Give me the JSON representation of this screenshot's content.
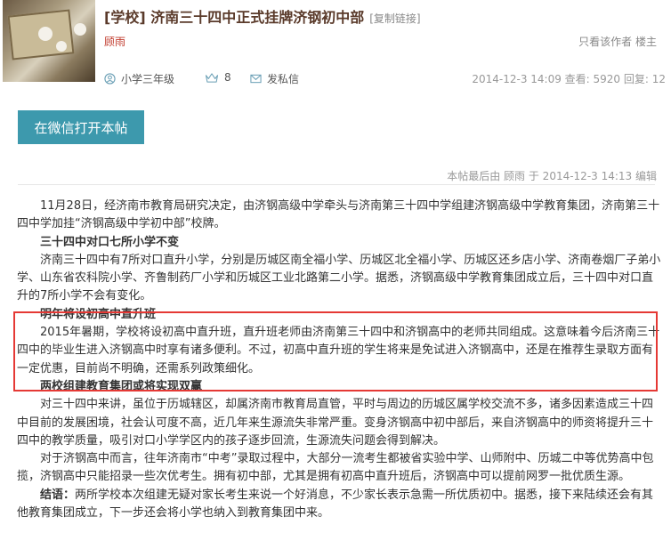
{
  "header": {
    "title": "[学校] 济南三十四中正式挂牌济钢初中部",
    "copy_link": "[复制链接]",
    "author": "顾雨",
    "author_only_prefix": "只看该作者",
    "author_only_link": "楼主"
  },
  "meta": {
    "grade": "小学三年级",
    "count": "8",
    "message": "发私信",
    "stats": "2014-12-3 14:09   查看: 5920   回复: 12"
  },
  "wechat_button": "在微信打开本帖",
  "edit_note": "本帖最后由 顾雨 于 2014-12-3 14:13 编辑",
  "article": {
    "p1": "11月28日，经济南市教育局研究决定，由济钢高级中学牵头与济南第三十四中学组建济钢高级中学教育集团，济南第三十四中学加挂“济钢高级中学初中部”校牌。",
    "h1": "三十四中对口七所小学不变",
    "p2": "济南三十四中有7所对口直升小学，分别是历城区南全福小学、历城区北全福小学、历城区还乡店小学、济南卷烟厂子弟小学、山东省农科院小学、齐鲁制药厂小学和历城区工业北路第二小学。据悉，济钢高级中学教育集团成立后，三十四中对口直升的7所小学不会有变化。",
    "h2": "明年将设初高中直升班",
    "p3": "2015年暑期，学校将设初高中直升班，直升班老师由济南第三十四中和济钢高中的老师共同组成。这意味着今后济南三十四中的毕业生进入济钢高中时享有诸多便利。不过，初高中直升班的学生将来是免试进入济钢高中，还是在推荐生录取方面有一定优惠，目前尚不明确，还需系列政策细化。",
    "h3": "两校组建教育集团或将实现双赢",
    "p4": "对三十四中来讲，虽位于历城辖区，却属济南市教育局直管，平时与周边的历城区属学校交流不多，诸多因素造成三十四中目前的发展困境，社会认可度不高，近几年来生源流失非常严重。变身济钢高中初中部后，来自济钢高中的师资将提升三十四中的教学质量，吸引对口小学学区内的孩子逐步回流，生源流失问题会得到解决。",
    "p5": "对于济钢高中而言，往年济南市“中考”录取过程中，大部分一流考生都被省实验中学、山师附中、历城二中等优势高中包揽，济钢高中只能招录一些次优考生。拥有初中部，尤其是拥有初高中直升班后，济钢高中可以提前网罗一批优质生源。",
    "p6_label": "结语：",
    "p6": "两所学校本次组建无疑对家长考生来说一个好消息，不少家长表示急需一所优质初中。据悉，接下来陆续还会有其他教育集团成立，下一步还会将小学也纳入到教育集团中来。"
  },
  "colors": {
    "title": "#5a3a2a",
    "author": "#c0392b",
    "button": "#3d99ad",
    "highlight": "#e53935"
  }
}
